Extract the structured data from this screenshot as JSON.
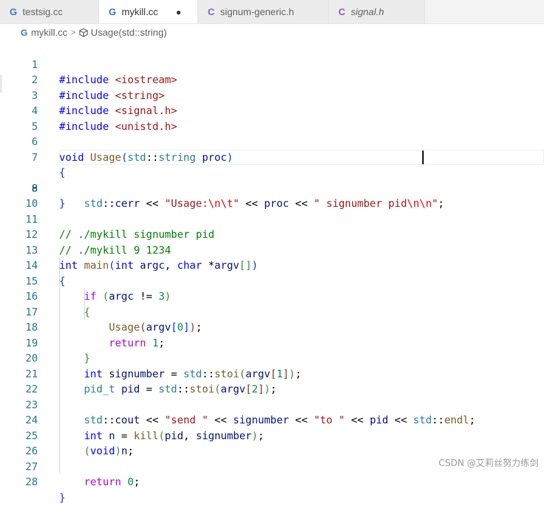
{
  "tabs": [
    {
      "icon": "C++",
      "label": "testsig.cc",
      "active": false
    },
    {
      "icon": "C++",
      "label": "mykill.cc",
      "active": true,
      "dirty": "●"
    },
    {
      "icon": "C",
      "label": "signum-generic.h",
      "active": false
    },
    {
      "icon": "C",
      "label": "signal.h",
      "active": false
    }
  ],
  "breadcrumb": {
    "file": "mykill.cc",
    "separator": ">",
    "symbol": "Usage(std::string)"
  },
  "editor": {
    "line_numbers": [
      "1",
      "2",
      "3",
      "4",
      "5",
      "6",
      "7",
      "8",
      "9",
      "10",
      "11",
      "12",
      "13",
      "14",
      "15",
      "16",
      "17",
      "18",
      "19",
      "20",
      "21",
      "22",
      "23",
      "24",
      "25",
      "26",
      "27",
      "28"
    ],
    "lines": [
      "#include <iostream>",
      "#include <string>",
      "#include <signal.h>",
      "#include <unistd.h>",
      "",
      "void Usage(std::string proc)",
      "{",
      "    std::cerr << \"Usage:\\n\\t\" << proc << \" signumber pid\\n\\n\";",
      "}",
      "",
      "// ./mykill signumber pid",
      "// ./mykill 9 1234",
      "int main(int argc, char *argv[])",
      "{",
      "    if (argc != 3)",
      "    {",
      "        Usage(argv[0]);",
      "        return 1;",
      "    }",
      "    int signumber = std::stoi(argv[1]);",
      "    pid_t pid = std::stoi(argv[2]);",
      "",
      "    std::cout << \"send \" << signumber << \"to \" << pid << std::endl;",
      "    int n = kill(pid, signumber);",
      "    (void)n;",
      "",
      "    return 0;",
      "}"
    ]
  },
  "watermark": "CSDN @艾莉丝努力练剑",
  "colors": {
    "keyword": "#0000ff",
    "control": "#af00db",
    "type": "#267f99",
    "variable": "#001080",
    "function": "#795e26",
    "string": "#a31515",
    "number": "#098658",
    "comment": "#008000",
    "line_number": "#237893"
  }
}
